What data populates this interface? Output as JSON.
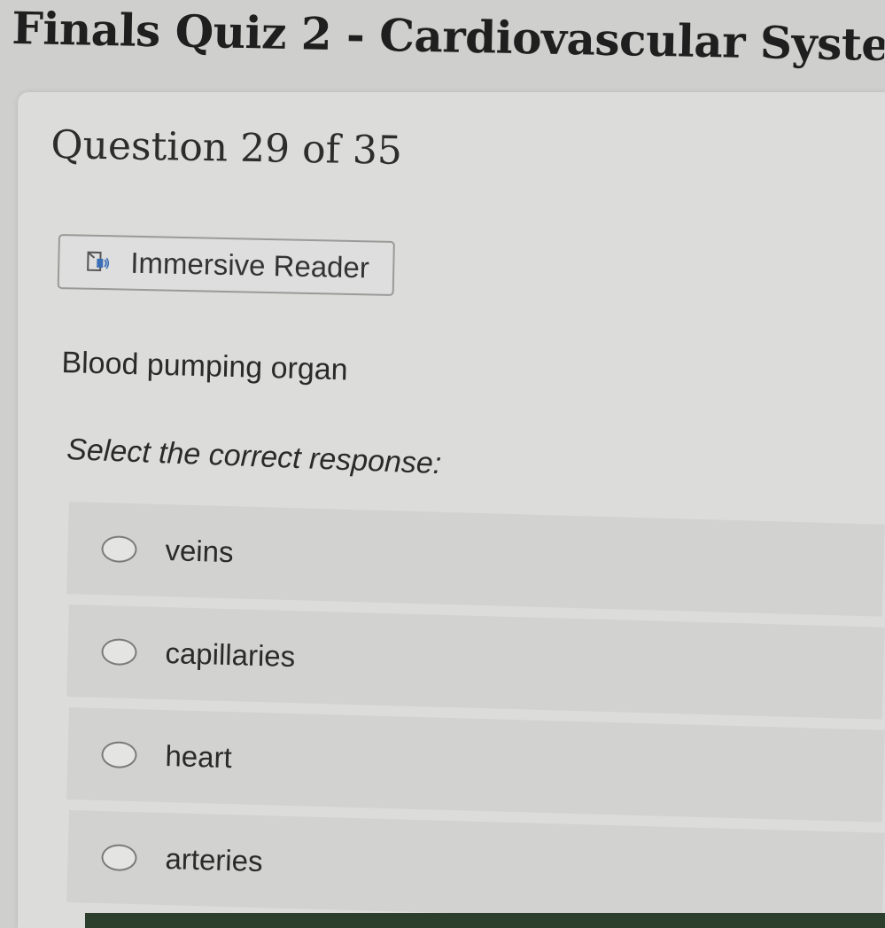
{
  "quiz": {
    "title": "Finals Quiz 2 - Cardiovascular Syste"
  },
  "question": {
    "heading": "Question 29 of 35",
    "text": "Blood pumping organ",
    "instruction": "Select the correct response:"
  },
  "immersive_reader": {
    "label": "Immersive Reader",
    "icon": "immersive-reader-icon"
  },
  "options": [
    {
      "label": "veins",
      "selected": false
    },
    {
      "label": "capillaries",
      "selected": false
    },
    {
      "label": "heart",
      "selected": false
    },
    {
      "label": "arteries",
      "selected": false
    }
  ],
  "colors": {
    "background": "#cfcfcd",
    "card": "#dcdcda",
    "option_row": "#d2d2d0",
    "icon_accent": "#3a6fb5"
  }
}
